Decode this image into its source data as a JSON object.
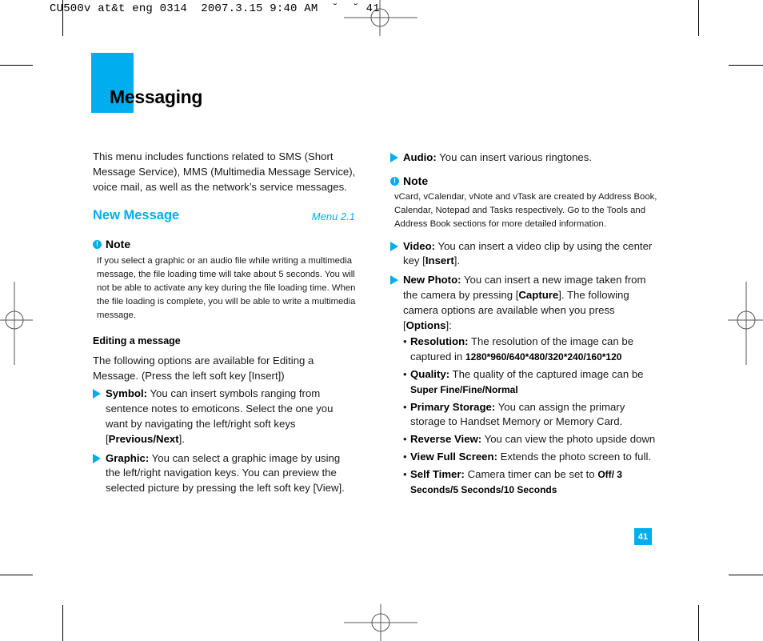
{
  "print_header": "CU500v at&t eng 0314  2007.3.15 9:40 AM  ˘  ˘ 41",
  "chapter_title": "Messaging",
  "intro": "This menu includes functions related to SMS (Short Message Service), MMS (Multimedia Message Service), voice mail, as well as the network’s service messages.",
  "section": {
    "title": "New Message",
    "menu_ref": "Menu 2.1"
  },
  "note1": {
    "heading": "Note",
    "icon": "exclamation-icon",
    "body": "If you select a graphic or an audio file while writing a multimedia message, the file loading time will take about 5 seconds. You will not be able to activate any key during the file loading time. When the file loading is complete, you will be able to write a multimedia message."
  },
  "editing": {
    "heading": "Editing a message",
    "intro": "The following options are available for Editing a Message. (Press the left soft key [Insert])",
    "items": [
      {
        "label": "Symbol:",
        "text": " You can insert symbols ranging from sentence notes to emoticons. Select the one you want by navigating the left/right soft keys [",
        "bold2": "Previous/Next",
        "tail": "]."
      },
      {
        "label": "Graphic:",
        "text": " You can select a graphic image by using the left/right navigation keys. You can preview the selected picture by pressing the left soft key [View].",
        "bold2": "",
        "tail": ""
      }
    ]
  },
  "right": {
    "audio": {
      "label": "Audio:",
      "text": " You can insert various ringtones."
    },
    "note2": {
      "heading": "Note",
      "body": "vCard, vCalendar, vNote and vTask are created by Address Book, Calendar, Notepad and Tasks respectively. Go to the Tools and Address Book sections for more detailed information."
    },
    "video": {
      "label": "Video:",
      "text": " You can insert a video clip by using the center key [",
      "bold2": "Insert",
      "tail": "]."
    },
    "new_photo": {
      "label": "New Photo:",
      "text1": " You can insert a new image taken from the camera by pressing [",
      "bold2": "Capture",
      "text2": "]. The following camera options are available when you press [",
      "bold3": "Options",
      "tail": "]:"
    },
    "camera_options": [
      {
        "label": "Resolution:",
        "text": " The resolution of the image can be captured in ",
        "bold2": "1280*960/640*480/320*240/160*120"
      },
      {
        "label": "Quality:",
        "text": " The quality of the captured image can be ",
        "bold2": "Super Fine/Fine/Normal"
      },
      {
        "label": "Primary Storage:",
        "text": " You can assign the primary storage to Handset Memory or Memory Card.",
        "bold2": ""
      },
      {
        "label": "Reverse View:",
        "text": " You can view the photo upside down",
        "bold2": ""
      },
      {
        "label": "View Full Screen:",
        "text": " Extends the photo screen to full.",
        "bold2": ""
      },
      {
        "label": "Self Timer:",
        "text": " Camera timer can be set to ",
        "bold2": "Off/ 3 Seconds/5 Seconds/10 Seconds"
      }
    ]
  },
  "page_number": "41",
  "colors": {
    "accent": "#00aeef",
    "text": "#1a1a1a"
  }
}
